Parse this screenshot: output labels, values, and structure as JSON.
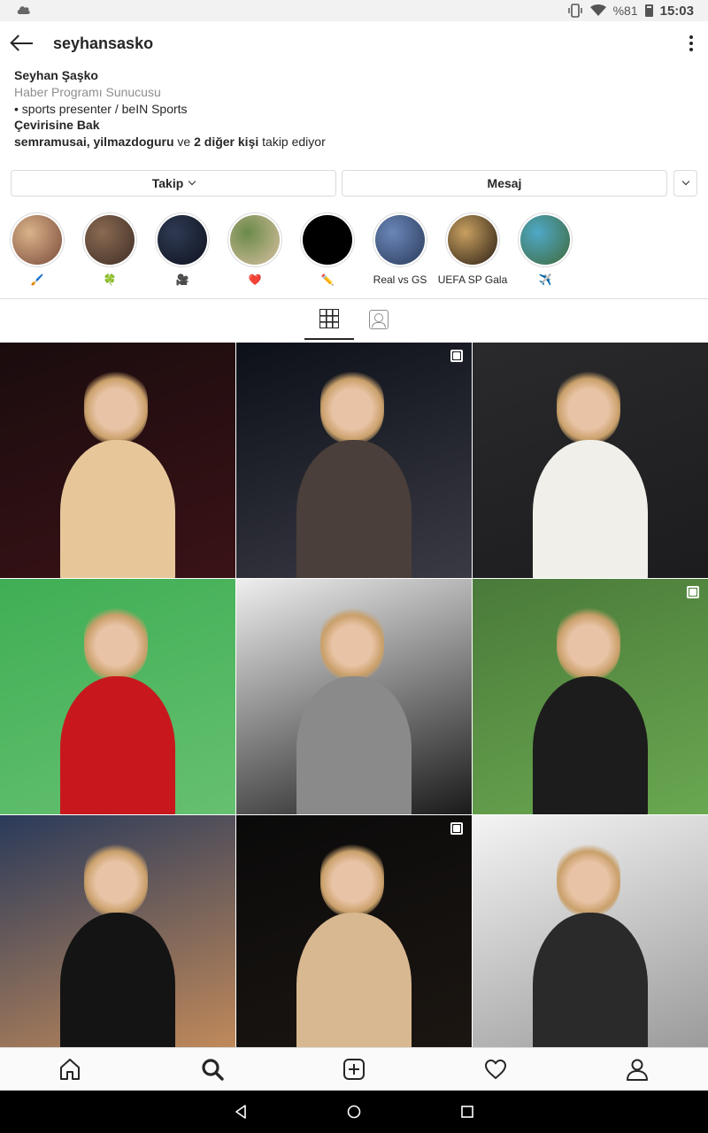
{
  "status_bar": {
    "battery": "%81",
    "clock": "15:03"
  },
  "header": {
    "username": "seyhansasko"
  },
  "bio": {
    "name": "Seyhan Şaşko",
    "category": "Haber Programı Sunucusu",
    "description": "• sports presenter / beIN Sports",
    "translate": "Çevirisine Bak",
    "followed_by": {
      "user1": "semramusai",
      "sep": ", ",
      "user2": "yilmazdoguru",
      "mid": " ve ",
      "others": "2 diğer kişi",
      "suffix": " takip ediyor"
    }
  },
  "buttons": {
    "follow": "Takip",
    "message": "Mesaj"
  },
  "highlights": [
    {
      "label": "🖌️",
      "color1": "#d9b38a",
      "color2": "#7a4a3a"
    },
    {
      "label": "🍀",
      "color1": "#8a6a52",
      "color2": "#3e2e26"
    },
    {
      "label": "🎥",
      "color1": "#2f3a52",
      "color2": "#0e1220"
    },
    {
      "label": "❤️",
      "color1": "#6b8a4a",
      "color2": "#d8c0a0"
    },
    {
      "label": "✏️",
      "color1": "#000000",
      "color2": "#000000"
    },
    {
      "label": "Real vs GS",
      "color1": "#6a86b8",
      "color2": "#2a3b5a"
    },
    {
      "label": "UEFA SP Gala",
      "color1": "#c8a060",
      "color2": "#2a1e14"
    },
    {
      "label": "✈️",
      "color1": "#4fa8c8",
      "color2": "#3f6a3a"
    }
  ],
  "tabs": {
    "grid": "grid",
    "tagged": "tagged"
  },
  "posts": [
    {
      "bg1": "#1a0c0e",
      "bg2": "#3a1216",
      "figure": "#e7c79a",
      "multi": false
    },
    {
      "bg1": "#0c1018",
      "bg2": "#3a3a44",
      "figure": "#4a3f3a",
      "multi": true
    },
    {
      "bg1": "#2a2a2c",
      "bg2": "#1c1c1e",
      "figure": "#f1efe9",
      "multi": false
    },
    {
      "bg1": "#3fae55",
      "bg2": "#66c070",
      "figure": "#c8181e",
      "multi": false
    },
    {
      "bg1": "#efefef",
      "bg2": "#1a1a1a",
      "figure": "#8a8a8a",
      "multi": false
    },
    {
      "bg1": "#4a7a3a",
      "bg2": "#6aa850",
      "figure": "#1c1c1c",
      "multi": true
    },
    {
      "bg1": "#2a3a5a",
      "bg2": "#c28a5a",
      "figure": "#141414",
      "multi": false
    },
    {
      "bg1": "#0a0a0a",
      "bg2": "#1c1612",
      "figure": "#d8b890",
      "multi": true
    },
    {
      "bg1": "#f4f4f4",
      "bg2": "#9a9a9a",
      "figure": "#2a2a2a",
      "multi": false
    }
  ],
  "bottom_nav": {
    "active": "search"
  },
  "colors": {
    "text": "#262626",
    "secondary": "#8e8e8e",
    "border": "#dbdbdb"
  }
}
